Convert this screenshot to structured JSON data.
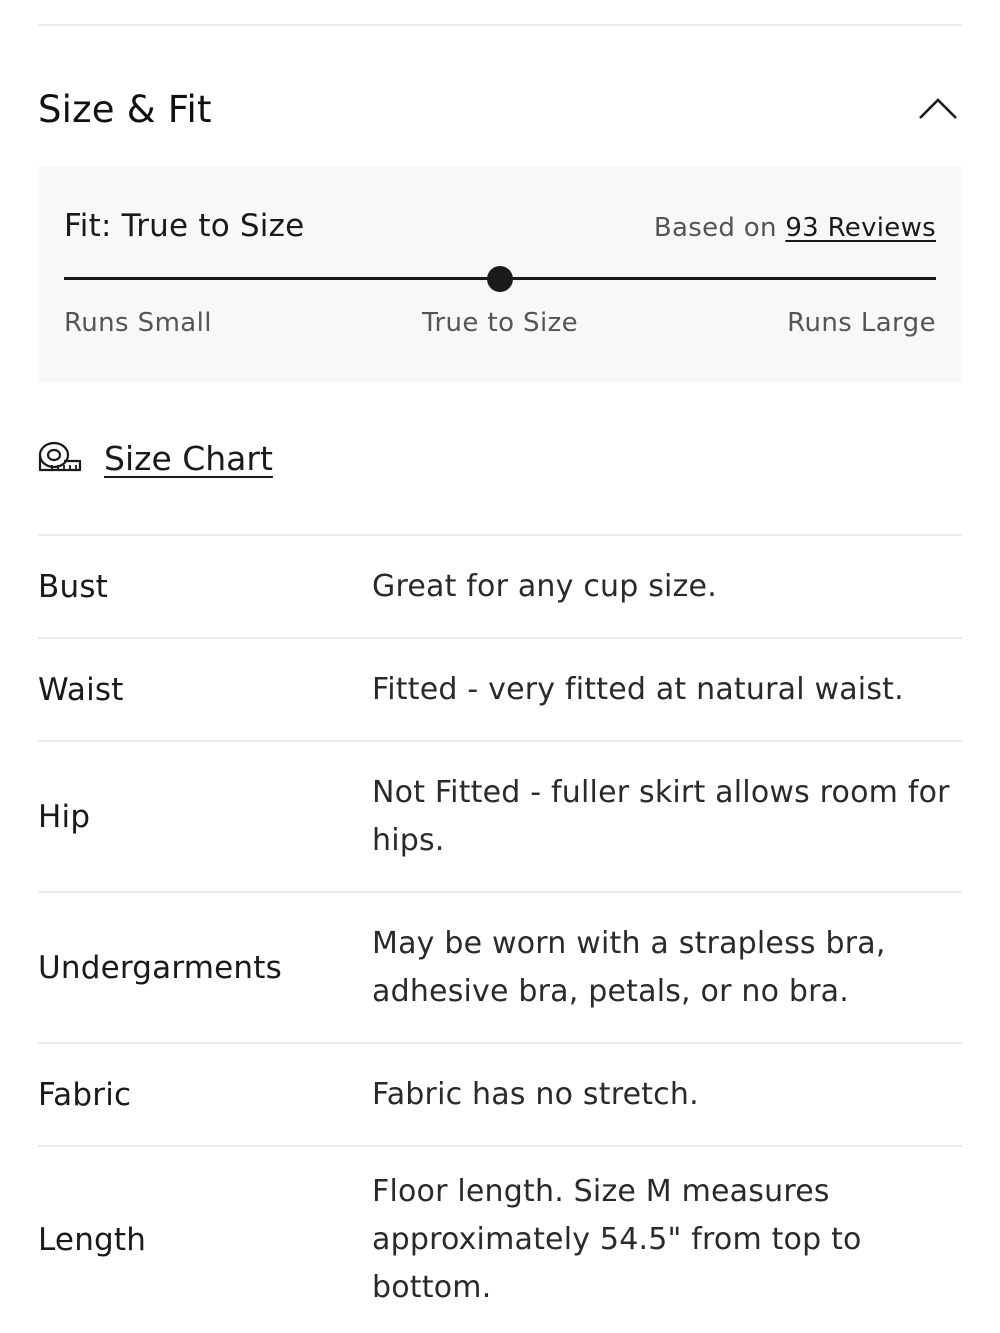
{
  "section": {
    "title": "Size & Fit",
    "expanded": true
  },
  "fit": {
    "label": "Fit: True to Size",
    "reviews_prefix": "Based on ",
    "reviews_link": "93 Reviews",
    "scale": {
      "min_label": "Runs Small",
      "mid_label": "True to Size",
      "max_label": "Runs Large",
      "position": 0.5
    }
  },
  "size_chart": {
    "label": "Size Chart",
    "icon": "measuring-tape-icon"
  },
  "specs": [
    {
      "label": "Bust",
      "value": "Great for any cup size."
    },
    {
      "label": "Waist",
      "value": "Fitted - very fitted at natural waist."
    },
    {
      "label": "Hip",
      "value": "Not Fitted - fuller skirt allows room for hips."
    },
    {
      "label": "Undergarments",
      "value": "May be worn with a strapless bra, adhesive bra, petals, or no bra."
    },
    {
      "label": "Fabric",
      "value": "Fabric has no stretch."
    },
    {
      "label": "Length",
      "value": "Floor length. Size M measures approximately 54.5\" from top to bottom."
    }
  ]
}
